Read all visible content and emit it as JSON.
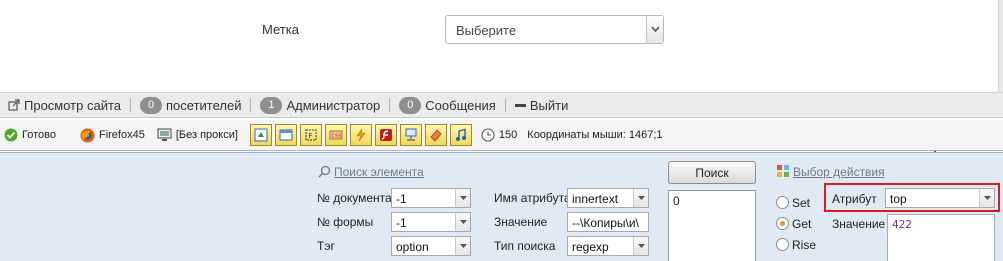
{
  "form": {
    "metka_label": "Метка",
    "select_value": "Выберите"
  },
  "admin_bar": {
    "view_site": "Просмотр сайта",
    "visitors_count": "0",
    "visitors_label": "посетителей",
    "admins_count": "1",
    "admins_label": "Администратор",
    "messages_count": "0",
    "messages_label": "Сообщения",
    "logout": "Выйти"
  },
  "status_bar": {
    "ready": "Готово",
    "browser": "Firefox45",
    "proxy": "[Без прокси]",
    "timer_value": "150",
    "mouse_coords": "Координаты мыши: 1467;1"
  },
  "panel": {
    "search_element_link": "Поиск элемента",
    "doc_label": "№ документа",
    "doc_value": "-1",
    "form_label": "№ формы",
    "form_value": "-1",
    "tag_label": "Тэг",
    "tag_value": "option",
    "attr_name_label": "Имя атрибута",
    "attr_name_value": "innertext",
    "value_label": "Значение",
    "value_value": "--\\Копиры\\и\\",
    "search_type_label": "Тип поиска",
    "search_type_value": "regexp",
    "search_button": "Поиск",
    "results": [
      "0"
    ],
    "action_link": "Выбор действия",
    "radio_set": "Set",
    "radio_get": "Get",
    "radio_rise": "Rise",
    "radio_selected": "Get",
    "attribute_label": "Атрибут",
    "attribute_value": "top",
    "result_value_label": "Значение",
    "result_value": "422"
  },
  "colors": {
    "highlight": "#d71f1f",
    "panel_bg": "#e1eaf4",
    "badge": "#8f8f8f"
  }
}
